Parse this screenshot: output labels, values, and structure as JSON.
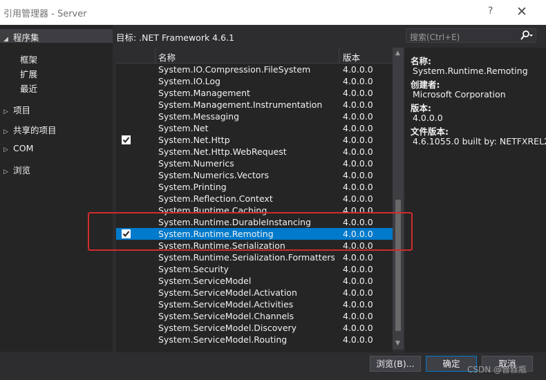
{
  "window": {
    "title": "引用管理器 - Server",
    "help": "?",
    "close": "✕"
  },
  "sidebar": {
    "header": "程序集",
    "sub_items": [
      "框架",
      "扩展",
      "最近"
    ],
    "items": [
      "项目",
      "共享的项目",
      "COM",
      "浏览"
    ]
  },
  "toolbar": {
    "target_label": "目标: .NET Framework 4.6.1",
    "search_placeholder": "搜索(Ctrl+E)"
  },
  "list": {
    "col_name": "名称",
    "col_version": "版本",
    "rows": [
      {
        "name": "System.IO.Compression.FileSystem",
        "version": "4.0.0.0",
        "checked": false,
        "selected": false
      },
      {
        "name": "System.IO.Log",
        "version": "4.0.0.0",
        "checked": false,
        "selected": false
      },
      {
        "name": "System.Management",
        "version": "4.0.0.0",
        "checked": false,
        "selected": false
      },
      {
        "name": "System.Management.Instrumentation",
        "version": "4.0.0.0",
        "checked": false,
        "selected": false
      },
      {
        "name": "System.Messaging",
        "version": "4.0.0.0",
        "checked": false,
        "selected": false
      },
      {
        "name": "System.Net",
        "version": "4.0.0.0",
        "checked": false,
        "selected": false
      },
      {
        "name": "System.Net.Http",
        "version": "4.0.0.0",
        "checked": true,
        "selected": false
      },
      {
        "name": "System.Net.Http.WebRequest",
        "version": "4.0.0.0",
        "checked": false,
        "selected": false
      },
      {
        "name": "System.Numerics",
        "version": "4.0.0.0",
        "checked": false,
        "selected": false
      },
      {
        "name": "System.Numerics.Vectors",
        "version": "4.0.0.0",
        "checked": false,
        "selected": false
      },
      {
        "name": "System.Printing",
        "version": "4.0.0.0",
        "checked": false,
        "selected": false
      },
      {
        "name": "System.Reflection.Context",
        "version": "4.0.0.0",
        "checked": false,
        "selected": false
      },
      {
        "name": "System.Runtime.Caching",
        "version": "4.0.0.0",
        "checked": false,
        "selected": false
      },
      {
        "name": "System.Runtime.DurableInstancing",
        "version": "4.0.0.0",
        "checked": false,
        "selected": false
      },
      {
        "name": "System.Runtime.Remoting",
        "version": "4.0.0.0",
        "checked": true,
        "selected": true
      },
      {
        "name": "System.Runtime.Serialization",
        "version": "4.0.0.0",
        "checked": false,
        "selected": false
      },
      {
        "name": "System.Runtime.Serialization.Formatters.S...",
        "version": "4.0.0.0",
        "checked": false,
        "selected": false
      },
      {
        "name": "System.Security",
        "version": "4.0.0.0",
        "checked": false,
        "selected": false
      },
      {
        "name": "System.ServiceModel",
        "version": "4.0.0.0",
        "checked": false,
        "selected": false
      },
      {
        "name": "System.ServiceModel.Activation",
        "version": "4.0.0.0",
        "checked": false,
        "selected": false
      },
      {
        "name": "System.ServiceModel.Activities",
        "version": "4.0.0.0",
        "checked": false,
        "selected": false
      },
      {
        "name": "System.ServiceModel.Channels",
        "version": "4.0.0.0",
        "checked": false,
        "selected": false
      },
      {
        "name": "System.ServiceModel.Discovery",
        "version": "4.0.0.0",
        "checked": false,
        "selected": false
      },
      {
        "name": "System.ServiceModel.Routing",
        "version": "4.0.0.0",
        "checked": false,
        "selected": false
      }
    ]
  },
  "details": {
    "name_label": "名称:",
    "name_value": "System.Runtime.Remoting",
    "creator_label": "创建者:",
    "creator_value": "Microsoft Corporation",
    "version_label": "版本:",
    "version_value": "4.0.0.0",
    "file_version_label": "文件版本:",
    "file_version_value": "4.6.1055.0 built by: NETFXREL2"
  },
  "buttons": {
    "browse": "浏览(B)...",
    "ok": "确定",
    "cancel": "取消"
  },
  "watermark": "CSDN @普丝瓶",
  "colors": {
    "selection": "#007acc",
    "highlight_box": "#d22b2b"
  }
}
